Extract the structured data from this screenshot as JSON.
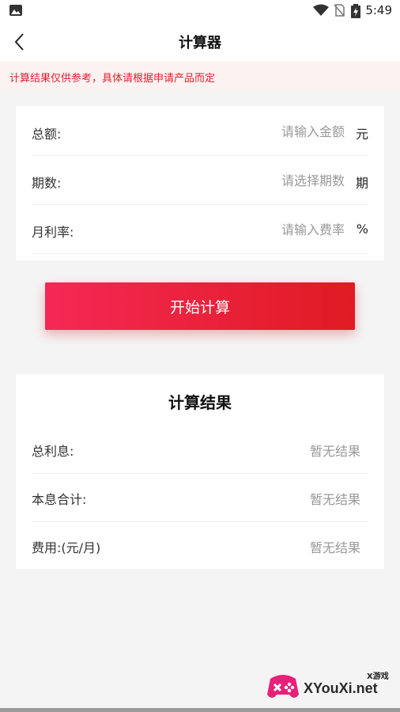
{
  "status_bar": {
    "time": "5:49"
  },
  "navbar": {
    "title": "计算器"
  },
  "notice": {
    "text": "计算结果仅供参考，具体请根据申请产品而定"
  },
  "inputs": [
    {
      "label": "总额:",
      "placeholder": "请输入金额",
      "unit": "元"
    },
    {
      "label": "期数:",
      "placeholder": "请选择期数",
      "unit": "期"
    },
    {
      "label": "月利率:",
      "placeholder": "请输入费率",
      "unit": "%"
    }
  ],
  "calculate_button": {
    "label": "开始计算"
  },
  "results": {
    "title": "计算结果",
    "rows": [
      {
        "label": "总利息:",
        "value": "暂无结果"
      },
      {
        "label": "本息合计:",
        "value": "暂无结果"
      },
      {
        "label": "费用:(元/月)",
        "value": "暂无结果"
      }
    ]
  },
  "watermark": {
    "brand": "XYouXi.net",
    "sub": "X游戏"
  },
  "colors": {
    "accent": "#e01b22",
    "accent_start": "#f52855",
    "notice_bg": "#fdf2f2",
    "background": "#f4f4f4"
  }
}
